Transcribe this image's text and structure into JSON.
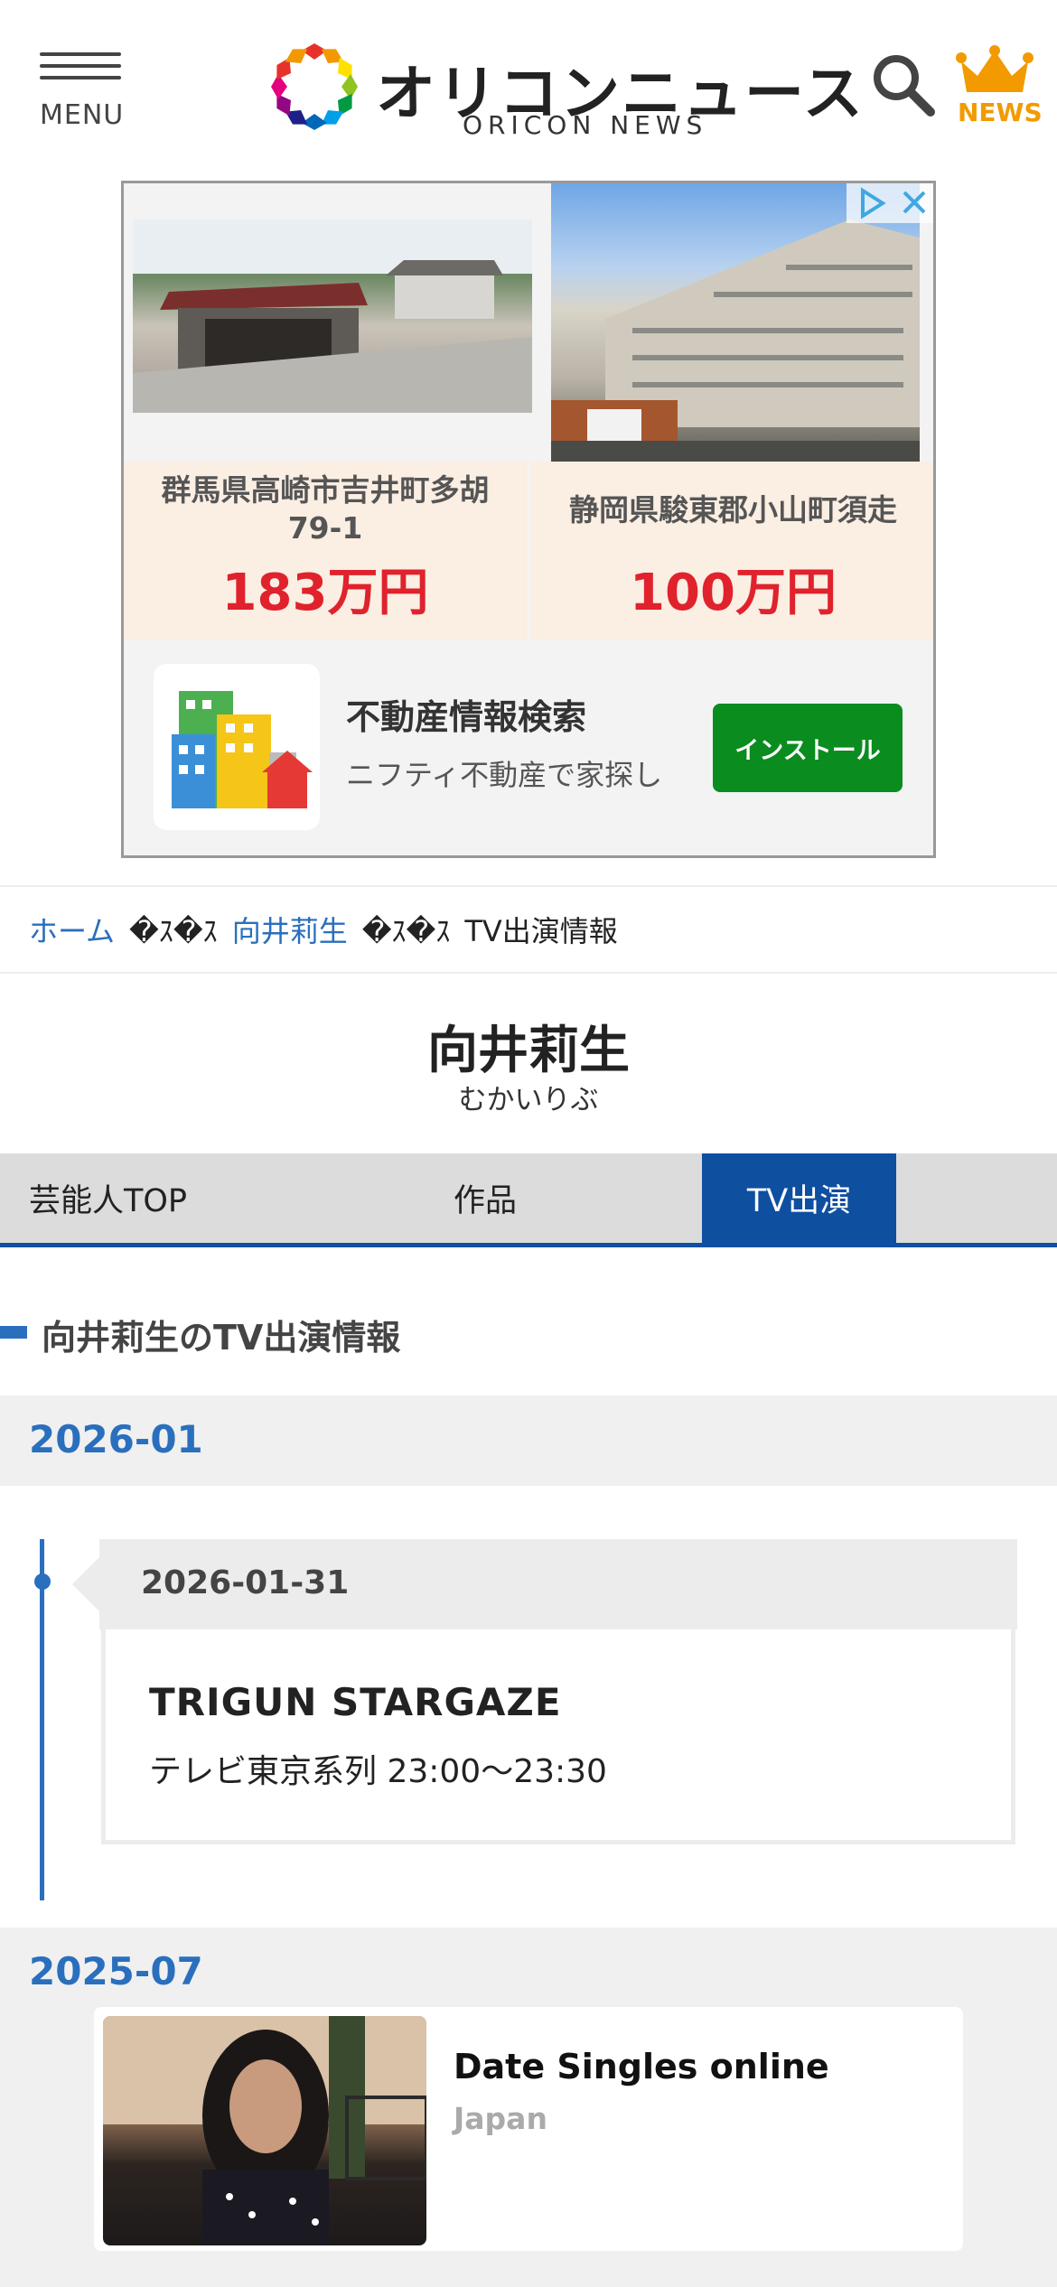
{
  "header": {
    "menu_label": "MENU",
    "logo_jp": "オリコンニュース",
    "logo_en": "ORICON NEWS",
    "news_label": "NEWS",
    "news_color": "#f29a00"
  },
  "ad_top": {
    "listings": [
      {
        "address": "群馬県高崎市吉井町多胡\n79-1",
        "address_line1": "群馬県高崎市吉井町多胡",
        "address_line2": "79-1",
        "price": "183万円"
      },
      {
        "address_line1": "静岡県駿東郡小山町須走",
        "price": "100万円"
      }
    ],
    "app_title": "不動産情報検索",
    "app_desc": "ニフティ不動産で家探し",
    "install_label": "インストール",
    "install_color": "#0a8c1f",
    "price_color": "#e0222d"
  },
  "breadcrumb": {
    "home": "ホーム",
    "separator": "�ｽ�ｽ",
    "artist": "向井莉生",
    "current": "TV出演情報"
  },
  "artist": {
    "name": "向井莉生",
    "kana": "むかいりぶ"
  },
  "tabs": [
    {
      "label": "芸能人TOP"
    },
    {
      "label": "作品"
    },
    {
      "label": "TV出演",
      "active": true
    }
  ],
  "section": {
    "title": "向井莉生のTV出演情報",
    "accent_color": "#2a6fbd"
  },
  "months": [
    {
      "label": "2026-01",
      "entries": [
        {
          "date": "2026-01-31",
          "program": "TRIGUN STARGAZE",
          "channel": "テレビ東京系列 23:00～23:30"
        }
      ]
    },
    {
      "label": "2025-07"
    }
  ],
  "ad_bottom": {
    "title": "Date Singles online",
    "subtitle": "Japan"
  }
}
